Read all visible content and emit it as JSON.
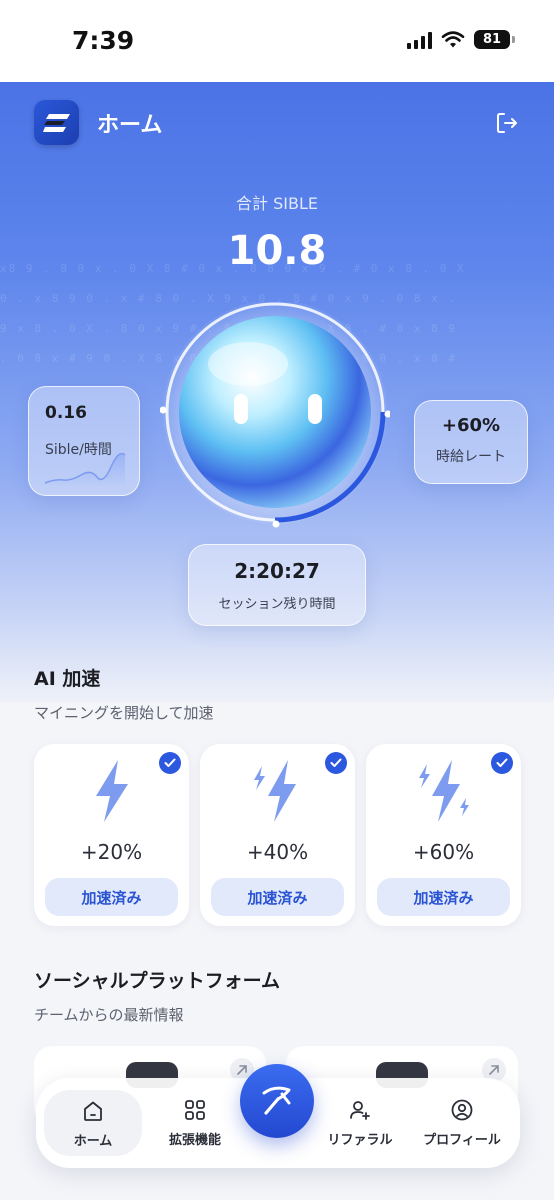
{
  "status_bar": {
    "time": "7:39",
    "battery": "81"
  },
  "header": {
    "title": "ホーム"
  },
  "total": {
    "label": "合計 SIBLE",
    "value": "10.8"
  },
  "stats": {
    "rate": {
      "value": "0.16",
      "label": "Sible/時間"
    },
    "boost": {
      "value": "+60%",
      "label": "時給レート"
    },
    "session": {
      "value": "2:20:27",
      "label": "セッション残り時間"
    }
  },
  "ai_boost": {
    "title": "AI 加速",
    "subtitle": "マイニングを開始して加速",
    "tiles": [
      {
        "percent": "+20%",
        "button": "加速済み"
      },
      {
        "percent": "+40%",
        "button": "加速済み"
      },
      {
        "percent": "+60%",
        "button": "加速済み"
      }
    ]
  },
  "social": {
    "title": "ソーシャルプラットフォーム",
    "subtitle": "チームからの最新情報"
  },
  "nav": {
    "items": [
      {
        "label": "ホーム"
      },
      {
        "label": "拡張機能"
      },
      {
        "label": "リファラル"
      },
      {
        "label": "プロフィール"
      }
    ]
  },
  "colors": {
    "accent": "#2c58e0",
    "hero_top": "#4b73e6",
    "tile_button_bg": "#e2e9fb"
  }
}
